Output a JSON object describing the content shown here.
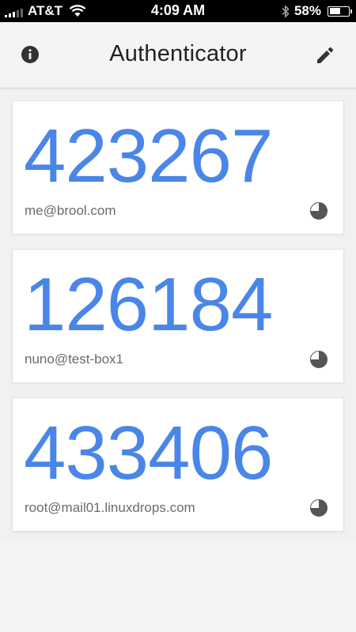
{
  "status_bar": {
    "carrier": "AT&T",
    "time": "4:09 AM",
    "battery_percent": "58%",
    "battery_level": 0.58
  },
  "app": {
    "title": "Authenticator",
    "info_icon": "info-icon",
    "edit_icon": "pencil-icon"
  },
  "accounts": [
    {
      "code": "423267",
      "name": "me@brool.com"
    },
    {
      "code": "126184",
      "name": "nuno@test-box1"
    },
    {
      "code": "433406",
      "name": "root@mail01.linuxdrops.com"
    }
  ],
  "colors": {
    "code": "#4a86e8",
    "timer": "#555555"
  }
}
